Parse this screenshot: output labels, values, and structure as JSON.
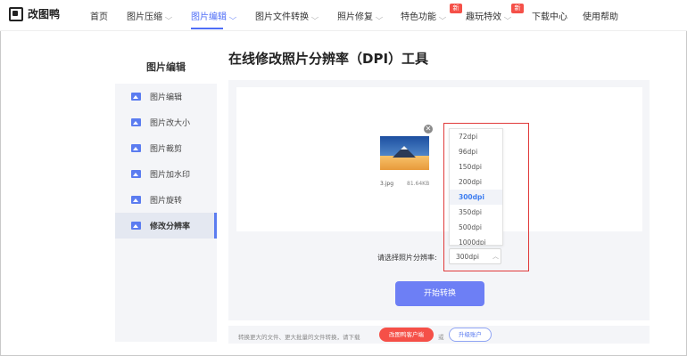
{
  "header": {
    "logo_text": "改图鸭",
    "nav": [
      {
        "label": "首页"
      },
      {
        "label": "图片压缩"
      },
      {
        "label": "图片编辑"
      },
      {
        "label": "图片文件转换"
      },
      {
        "label": "照片修复"
      },
      {
        "label": "特色功能",
        "badge": "新"
      },
      {
        "label": "趣玩特效",
        "badge": "新"
      },
      {
        "label": "下载中心"
      },
      {
        "label": "使用帮助"
      }
    ],
    "active_nav": "图片编辑"
  },
  "sidebar": {
    "title": "图片编辑",
    "items": [
      {
        "label": "图片编辑"
      },
      {
        "label": "图片改大小"
      },
      {
        "label": "图片裁剪"
      },
      {
        "label": "图片加水印"
      },
      {
        "label": "图片旋转"
      },
      {
        "label": "修改分辨率"
      }
    ],
    "active_index": 5
  },
  "main": {
    "page_title": "在线修改照片分辨率（DPI）工具",
    "file": {
      "name": "3.jpg",
      "size": "81.64KB",
      "remove_icon": "close-icon"
    },
    "dpi_label": "请选择照片分辨率:",
    "dpi_selected": "300dpi",
    "dpi_options": [
      "72dpi",
      "96dpi",
      "150dpi",
      "200dpi",
      "300dpi",
      "350dpi",
      "500dpi",
      "1000dpi"
    ],
    "start_button": "开始转换"
  },
  "footer": {
    "notice": "转换更大的文件、更大批量的文件转换，请下载",
    "client_button": "改图鸭客户端",
    "or_text": "或",
    "upgrade_button": "升级账户"
  },
  "colors": {
    "accent": "#4f6ef7",
    "button": "#6d7ff5",
    "highlight_box": "#e03a3a",
    "badge": "#f55048"
  }
}
